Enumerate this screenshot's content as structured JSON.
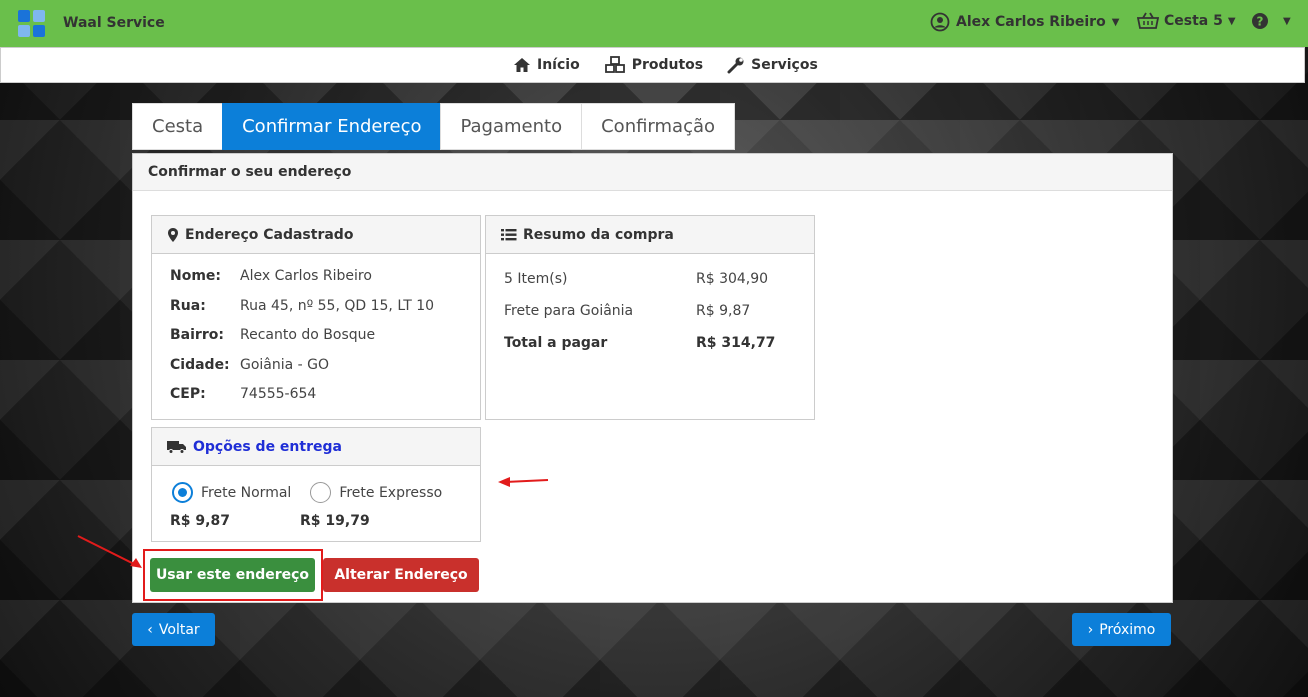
{
  "app": {
    "title": "Waal Service"
  },
  "header": {
    "user_name": "Alex Carlos Ribeiro",
    "cart_label": "Cesta 5",
    "help_icon": "question-circle-icon"
  },
  "nav": {
    "items": [
      {
        "label": "Início",
        "icon": "home-icon"
      },
      {
        "label": "Produtos",
        "icon": "cubes-icon"
      },
      {
        "label": "Serviços",
        "icon": "wrench-icon"
      }
    ]
  },
  "tabs": [
    {
      "label": "Cesta",
      "active": false
    },
    {
      "label": "Confirmar Endereço",
      "active": true
    },
    {
      "label": "Pagamento",
      "active": false
    },
    {
      "label": "Confirmação",
      "active": false
    }
  ],
  "panel": {
    "heading": "Confirmar o seu endereço"
  },
  "address": {
    "title": "Endereço Cadastrado",
    "rows": [
      {
        "key": "Nome:",
        "value": "Alex Carlos Ribeiro"
      },
      {
        "key": "Rua:",
        "value": "Rua 45, nº 55, QD 15, LT 10"
      },
      {
        "key": "Bairro:",
        "value": "Recanto do Bosque"
      },
      {
        "key": "Cidade:",
        "value": "Goiânia - GO"
      },
      {
        "key": "CEP:",
        "value": "74555-654"
      }
    ]
  },
  "summary": {
    "title": "Resumo da compra",
    "rows": [
      {
        "label": "5 Item(s)",
        "value": "R$ 304,90"
      },
      {
        "label": "Frete para Goiânia",
        "value": "R$ 9,87"
      },
      {
        "label": "Total a pagar",
        "value": "R$ 314,77"
      }
    ]
  },
  "delivery": {
    "title": "Opções de entrega",
    "options": [
      {
        "label": "Frete Normal",
        "price": "R$ 9,87",
        "checked": true
      },
      {
        "label": "Frete Expresso",
        "price": "R$ 19,79",
        "checked": false
      }
    ]
  },
  "actions": {
    "use_address": "Usar este endereço",
    "change_address": "Alterar Endereço"
  },
  "footer": {
    "back": "Voltar",
    "next": "Próximo"
  },
  "colors": {
    "topbar": "#6abf4b",
    "accent_blue": "#0c7fd9",
    "green_button": "#3a8f3e",
    "red_button": "#c9302c",
    "annotation_red": "#e21b1b"
  }
}
